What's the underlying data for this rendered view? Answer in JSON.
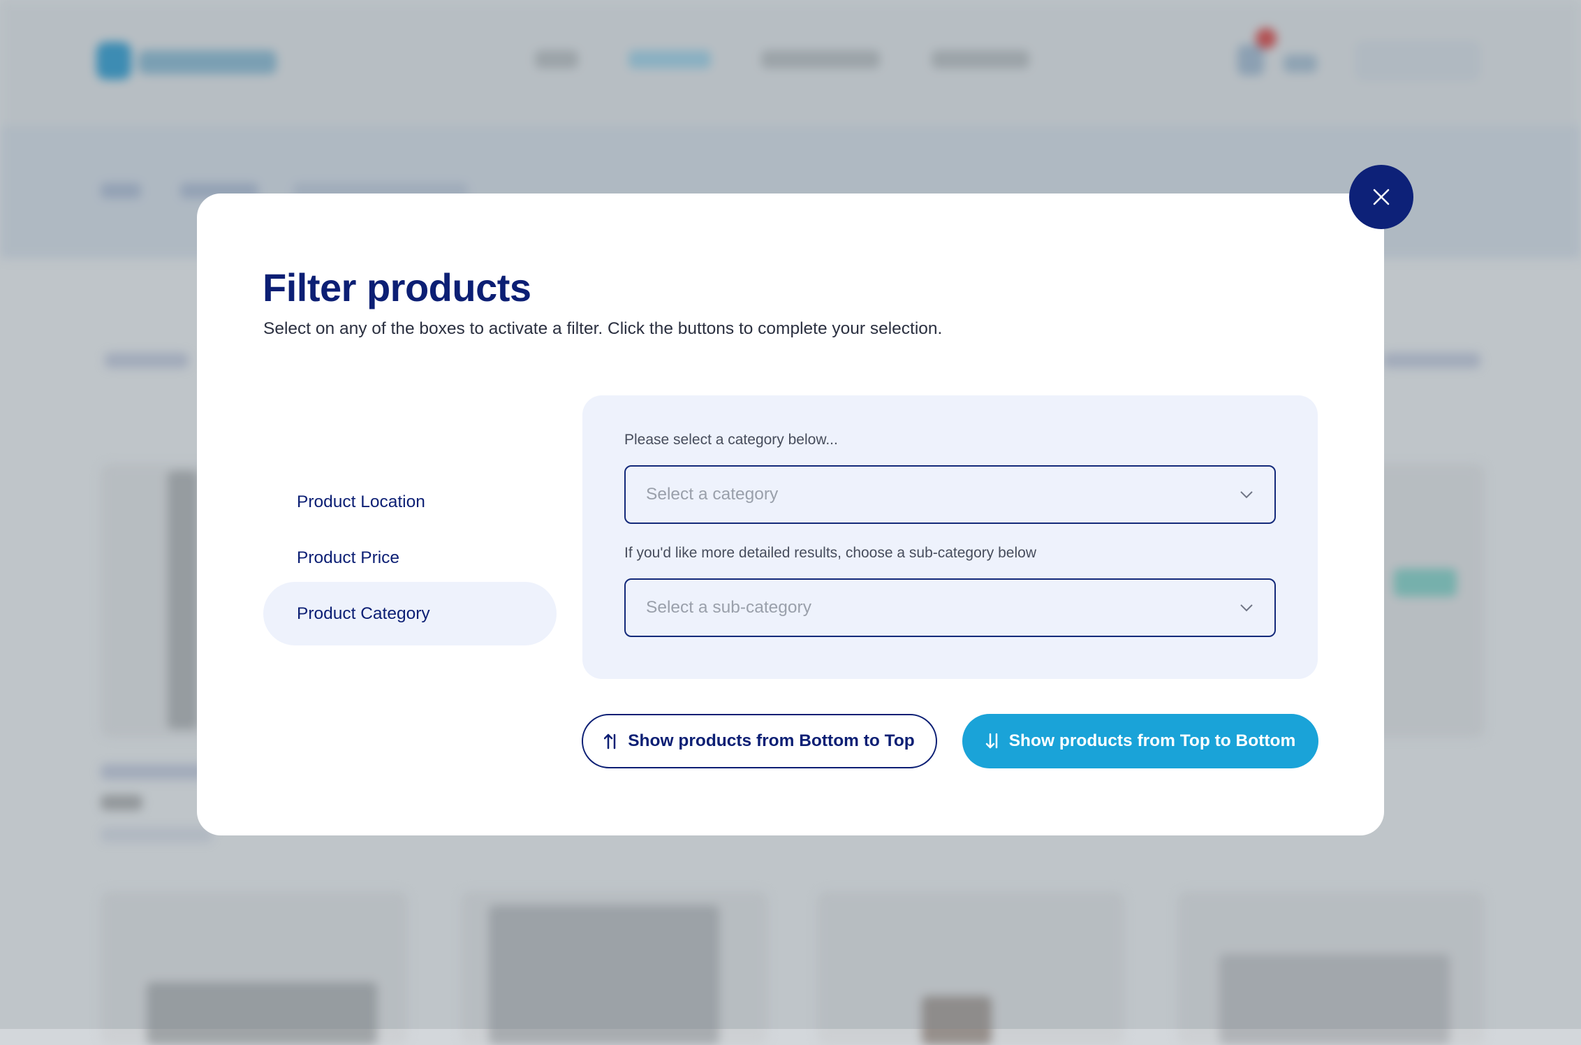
{
  "modal": {
    "title": "Filter products",
    "subtitle": "Select on any of the boxes to activate a filter. Click the buttons to complete your selection.",
    "close_icon": "close-icon"
  },
  "tabs": [
    {
      "label": "Product Location",
      "active": false
    },
    {
      "label": "Product Price",
      "active": false
    },
    {
      "label": "Product Category",
      "active": true
    }
  ],
  "category_panel": {
    "category_label": "Please select a category below...",
    "category_placeholder": "Select a category",
    "subcategory_label": "If you'd like more detailed results, choose a sub-category below",
    "subcategory_placeholder": "Select a sub-category"
  },
  "actions": {
    "bottom_to_top_label": "Show products from Bottom to Top",
    "bottom_to_top_icon": "sort-up-icon",
    "top_to_bottom_label": "Show products from Top to Bottom",
    "top_to_bottom_icon": "sort-down-icon"
  },
  "colors": {
    "primary_navy": "#0c1f74",
    "accent_blue": "#1aa3d8",
    "panel_bg": "#eef2fc"
  }
}
